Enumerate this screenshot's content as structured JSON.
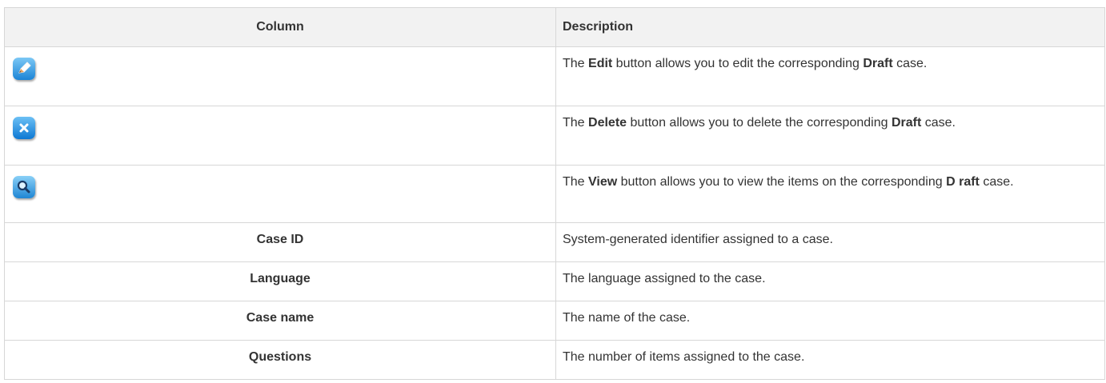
{
  "headers": {
    "column": "Column",
    "description": "Description"
  },
  "icon_rows": [
    {
      "icon": "pencil-edit-icon",
      "pre": "The ",
      "button": "Edit",
      "mid": " button allows you to edit the corresponding ",
      "draft": "Draft",
      "post": " case."
    },
    {
      "icon": "x-delete-icon",
      "pre": "The ",
      "button": "Delete",
      "mid": " button allows you to delete the corresponding ",
      "draft": "Draft",
      "post": " case."
    },
    {
      "icon": "magnifier-view-icon",
      "pre": "The ",
      "button": "View",
      "mid": " button allows you to view the items on the corresponding ",
      "draft": "D raft",
      "post": " case."
    }
  ],
  "text_rows": [
    {
      "name": "Case ID",
      "description": "System-generated identifier assigned to a case."
    },
    {
      "name": "Language",
      "description": "The language assigned to the case."
    },
    {
      "name": "Case name",
      "description": "The name of the case."
    },
    {
      "name": "Questions",
      "description": "The number of items assigned to the case."
    }
  ],
  "colors": {
    "header_bg": "#f2f2f2",
    "border": "#d7d7d7",
    "text": "#333333",
    "icon_blue": "#1b84d6"
  }
}
